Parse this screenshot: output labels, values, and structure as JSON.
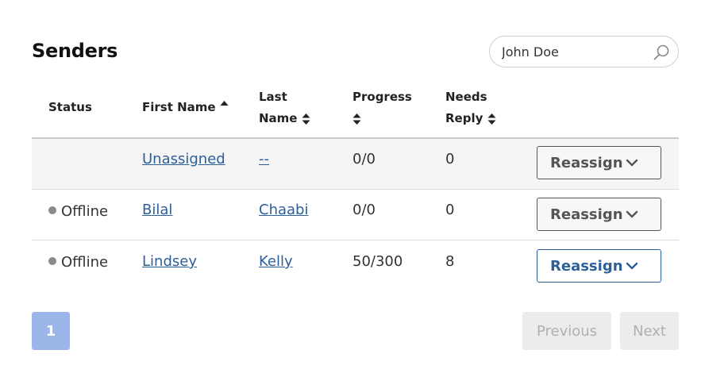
{
  "header": {
    "title": "Senders"
  },
  "search": {
    "value": "John Doe",
    "icon": "search-icon"
  },
  "table": {
    "columns": {
      "status": "Status",
      "first_name": "First Name",
      "last_name_line1": "Last",
      "last_name_line2": "Name",
      "progress": "Progress",
      "needs_reply_line1": "Needs",
      "needs_reply_line2": "Reply"
    },
    "rows": [
      {
        "status": "",
        "first_name": "Unassigned",
        "last_name": "--",
        "progress": "0/0",
        "needs_reply": "0",
        "action": "Reassign"
      },
      {
        "status": "Offline",
        "first_name": "Bilal",
        "last_name": "Chaabi",
        "progress": "0/0",
        "needs_reply": "0",
        "action": "Reassign"
      },
      {
        "status": "Offline",
        "first_name": "Lindsey",
        "last_name": "Kelly",
        "progress": "50/300",
        "needs_reply": "8",
        "action": "Reassign"
      }
    ]
  },
  "pagination": {
    "current_page": "1",
    "previous": "Previous",
    "next": "Next"
  },
  "colors": {
    "link": "#2d5f9a",
    "page_active": "#9bb6e8",
    "status_dot": "#8a8a8a"
  }
}
